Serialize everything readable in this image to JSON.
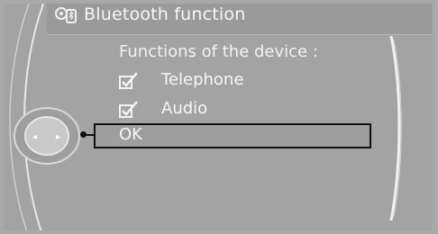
{
  "header": {
    "title": "Bluetooth function",
    "icon": "bluetooth-settings-icon"
  },
  "menu": {
    "heading": "Functions of the device :",
    "items": [
      {
        "label": "Telephone",
        "checked": true
      },
      {
        "label": "Audio",
        "checked": true
      }
    ],
    "ok_label": "OK"
  },
  "controller": {
    "icon": "idrive-controller-icon",
    "left_arrow": "◂",
    "right_arrow": "▸"
  },
  "colors": {
    "background": "#a3a3a3",
    "text": "#f7f7f7",
    "selection_border": "#111111"
  }
}
